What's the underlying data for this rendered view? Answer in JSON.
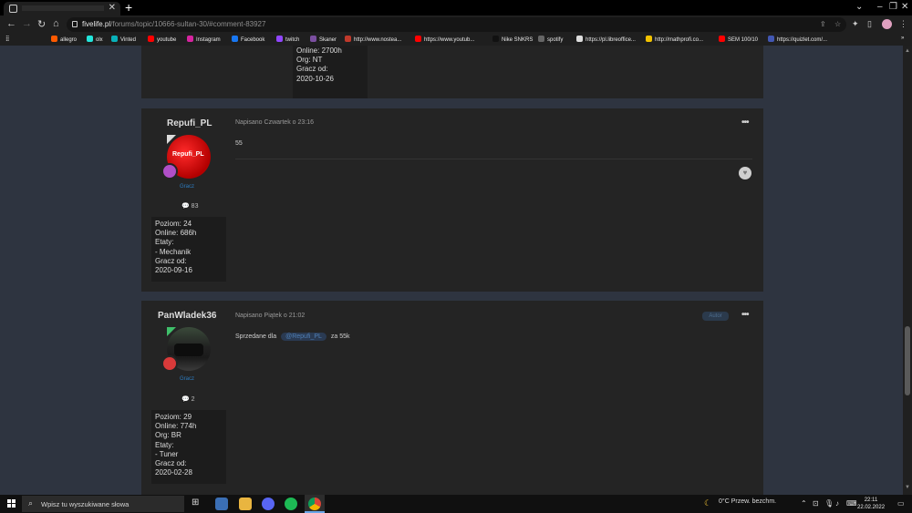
{
  "browser": {
    "url_host": "fivelife.pl",
    "url_path": "/forums/topic/10666-sultan-30/#comment-83927",
    "new_tab": "+",
    "window_controls": {
      "minimize": "–",
      "maximize": "❐",
      "close": "✕"
    },
    "bookmarks": [
      {
        "label": "allegro",
        "color": "#ff5a00"
      },
      {
        "label": "olx",
        "color": "#23e5db"
      },
      {
        "label": "Vinted",
        "color": "#09b1ba"
      },
      {
        "label": "youtube",
        "color": "#ff0000"
      },
      {
        "label": "Instagram",
        "color": "#d6249f"
      },
      {
        "label": "Facebook",
        "color": "#1877f2"
      },
      {
        "label": "twitch",
        "color": "#9146ff"
      },
      {
        "label": "Skaner",
        "color": "#7b4fa0"
      },
      {
        "label": "http://www.nostea...",
        "color": "#c0392b"
      },
      {
        "label": "https://www.youtub...",
        "color": "#ff0000"
      },
      {
        "label": "Nike SNKRS",
        "color": "#111111"
      },
      {
        "label": "spotify",
        "color": "#666666"
      },
      {
        "label": "https://pl.libreoffice...",
        "color": "#dddddd"
      },
      {
        "label": "http://mathprofi.co...",
        "color": "#f2c200"
      },
      {
        "label": "SEM 100/10",
        "color": "#ff0000"
      },
      {
        "label": "https://quizlet.com/...",
        "color": "#4257b2"
      }
    ],
    "bookmarks_more": "»"
  },
  "posts": [
    {
      "stats": [
        "Online: 2700h",
        "Org: NT",
        "Gracz od:",
        "2020-10-26"
      ]
    },
    {
      "username": "Repufi_PL",
      "avatar_label": "Repufi_PL",
      "group": "Gracz",
      "post_count": "83",
      "stats": [
        "Poziom: 24",
        "Online: 686h",
        "Etaty:",
        "- Mechanik",
        "Gracz od:",
        "2020-09-16"
      ],
      "meta": "Napisano Czwartek o 23:16",
      "content": "55",
      "more": "•••"
    },
    {
      "username": "PanWladek36",
      "group": "Gracz",
      "post_count": "2",
      "stats": [
        "Poziom: 29",
        "Online: 774h",
        "Org: BR",
        "Etaty:",
        "- Tuner",
        "Gracz od:",
        "2020-02-28"
      ],
      "meta": "Napisano Piątek o 21:02",
      "author_badge": "Autor",
      "content_pre": "Sprzedane dla",
      "mention": "@Repufi_PL",
      "content_post": "za 55k",
      "more": "•••"
    }
  ],
  "taskbar": {
    "search_placeholder": "Wpisz tu wyszukiwane słowa",
    "weather": "0°C  Przew. bezchm.",
    "time": "22:11",
    "date": "22.02.2022"
  }
}
